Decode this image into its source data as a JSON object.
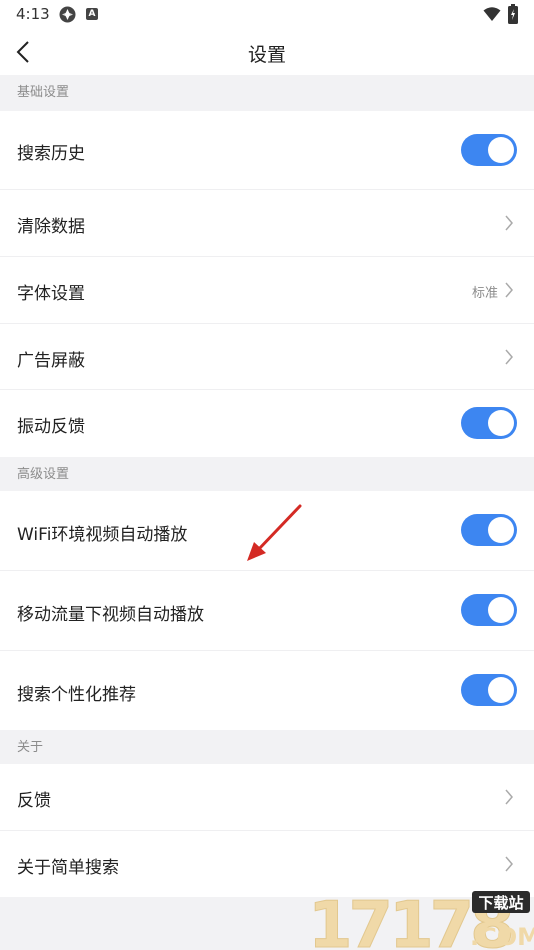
{
  "status_bar": {
    "time": "4:13",
    "icon_a": "gear-badge-icon",
    "icon_b": "A"
  },
  "nav": {
    "title": "设置",
    "back_icon": "chevron-left-icon"
  },
  "sections": {
    "basic": {
      "header": "基础设置",
      "items": [
        {
          "label": "搜索历史",
          "control": "toggle",
          "on": true
        },
        {
          "label": "清除数据",
          "control": "chevron"
        },
        {
          "label": "字体设置",
          "control": "chevron",
          "value": "标准"
        },
        {
          "label": "广告屏蔽",
          "control": "chevron"
        },
        {
          "label": "振动反馈",
          "control": "toggle",
          "on": true
        }
      ]
    },
    "advanced": {
      "header": "高级设置",
      "items": [
        {
          "label": "WiFi环境视频自动播放",
          "control": "toggle",
          "on": true
        },
        {
          "label": "移动流量下视频自动播放",
          "control": "toggle",
          "on": true
        },
        {
          "label": "搜索个性化推荐",
          "control": "toggle",
          "on": true
        }
      ]
    },
    "about": {
      "header": "关于",
      "items": [
        {
          "label": "反馈",
          "control": "chevron"
        },
        {
          "label": "关于简单搜索",
          "control": "chevron"
        }
      ]
    }
  },
  "watermark": {
    "digits": "17178",
    "tag": "下载站",
    "domain": ".COM"
  },
  "colors": {
    "accent": "#3d86f1",
    "arrow": "#d42a24",
    "background": "#f2f2f4"
  }
}
